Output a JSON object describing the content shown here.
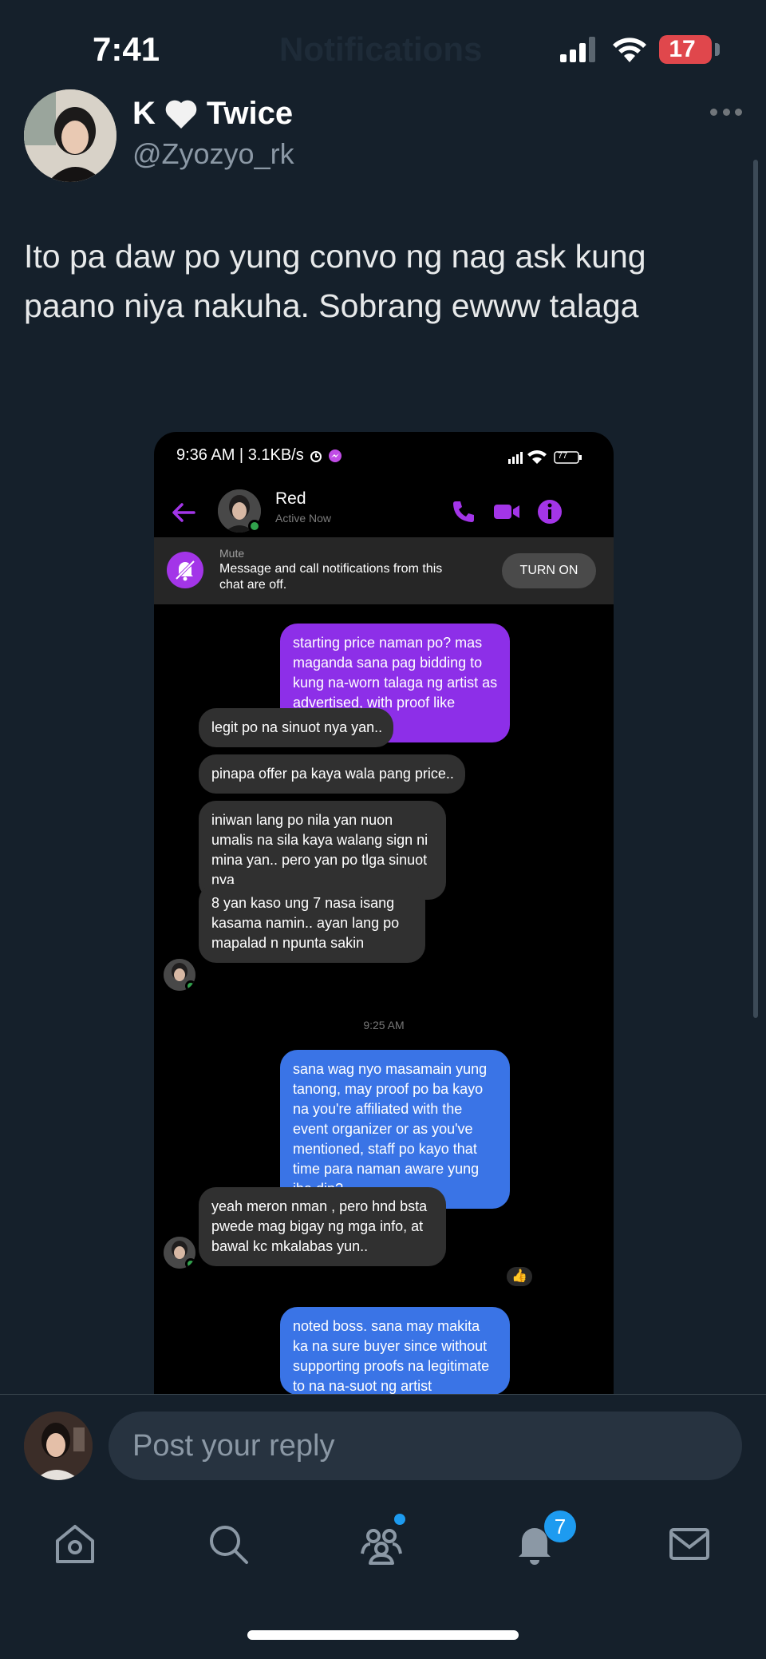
{
  "status_bar": {
    "time": "7:41",
    "ghost_title": "Notifications",
    "battery": "17"
  },
  "tweet": {
    "display_name": "K",
    "display_name_suffix": "Twice",
    "handle": "@Zyozyo_rk",
    "text": "Ito pa daw po yung convo ng nag ask kung paano niya nakuha. Sobrang ewww talaga"
  },
  "screenshot": {
    "status": "9:36 AM | 3.1KB/s",
    "battery": "77",
    "contact_name": "Red",
    "contact_status": "Active Now",
    "mute": {
      "label": "Mute",
      "text": "Message and call notifications from this chat are off.",
      "button": "TURN ON"
    },
    "messages": [
      {
        "text": "starting price naman po? mas maganda sana pag bidding to kung na-worn talaga ng artist as advertised, with proof like signed"
      },
      {
        "text": "legit po na sinuot nya yan.."
      },
      {
        "text": "pinapa offer pa kaya wala pang price.."
      },
      {
        "text": "iniwan lang po nila yan nuon umalis na sila kaya walang sign ni mina yan.. pero yan po tlga sinuot nya"
      },
      {
        "text": "8 yan kaso ung 7 nasa isang kasama namin.. ayan lang po mapalad n npunta sakin"
      },
      {
        "text": "sana wag nyo masamain yung tanong, may proof po ba kayo na you're affiliated with the event organizer or as you've mentioned, staff po kayo that time para naman aware yung iba din?"
      },
      {
        "text": "yeah meron nman , pero hnd bsta pwede mag bigay ng mga info, at bawal kc mkalabas yun.."
      },
      {
        "text": "noted boss. sana may makita ka na sure buyer since without supporting proofs na legitimate to na na-suot ng artist"
      }
    ],
    "timestamp": "9:25 AM",
    "reaction": "👍"
  },
  "reply": {
    "placeholder": "Post your reply"
  },
  "tabs": {
    "notifications_badge": "7"
  },
  "colors": {
    "background": "#15202b",
    "accent": "#1d9bf0",
    "messenger_purple": "#8d2fe8",
    "messenger_blue": "#3a74e6"
  }
}
